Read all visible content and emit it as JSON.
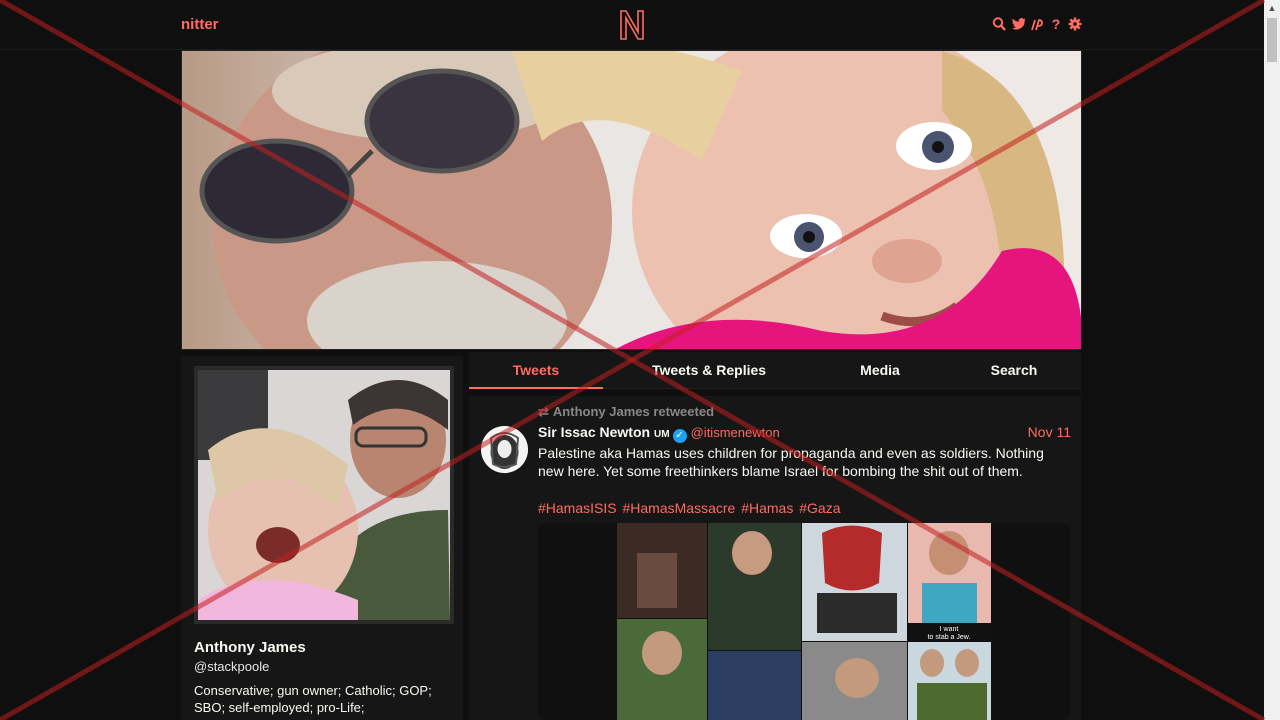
{
  "navbar": {
    "brand": "nitter",
    "logo_letter": "N",
    "icons": [
      "search-icon",
      "twitter-icon",
      "rss-icon",
      "help-icon",
      "settings-icon"
    ]
  },
  "profile": {
    "name": "Anthony James",
    "handle": "@stackpoole",
    "bio": "Conservative; gun owner; Catholic; GOP; SBO; self-employed; pro-Life;"
  },
  "tabs": [
    {
      "label": "Tweets",
      "active": true
    },
    {
      "label": "Tweets & Replies",
      "active": false
    },
    {
      "label": "Media",
      "active": false
    },
    {
      "label": "Search",
      "active": false
    }
  ],
  "tweet": {
    "retweet_header": "Anthony James retweeted",
    "author_name": "Sir Issac Newton",
    "author_badge": "UM",
    "author_handle": "@itismenewton",
    "date": "Nov 11",
    "text": "Palestine aka Hamas uses children for propaganda and even as soldiers. Nothing new here. Yet some freethinkers blame Israel for bombing the shit out of them.",
    "hashtags": [
      "#HamasISIS",
      "#HamasMassacre",
      "#Hamas",
      " #Gaza"
    ],
    "image_caption": "I want to stab a Jew."
  },
  "colors": {
    "accent": "#ff6c60",
    "background": "#0f0f0f",
    "card": "#161616",
    "verified": "#1da1f2"
  }
}
